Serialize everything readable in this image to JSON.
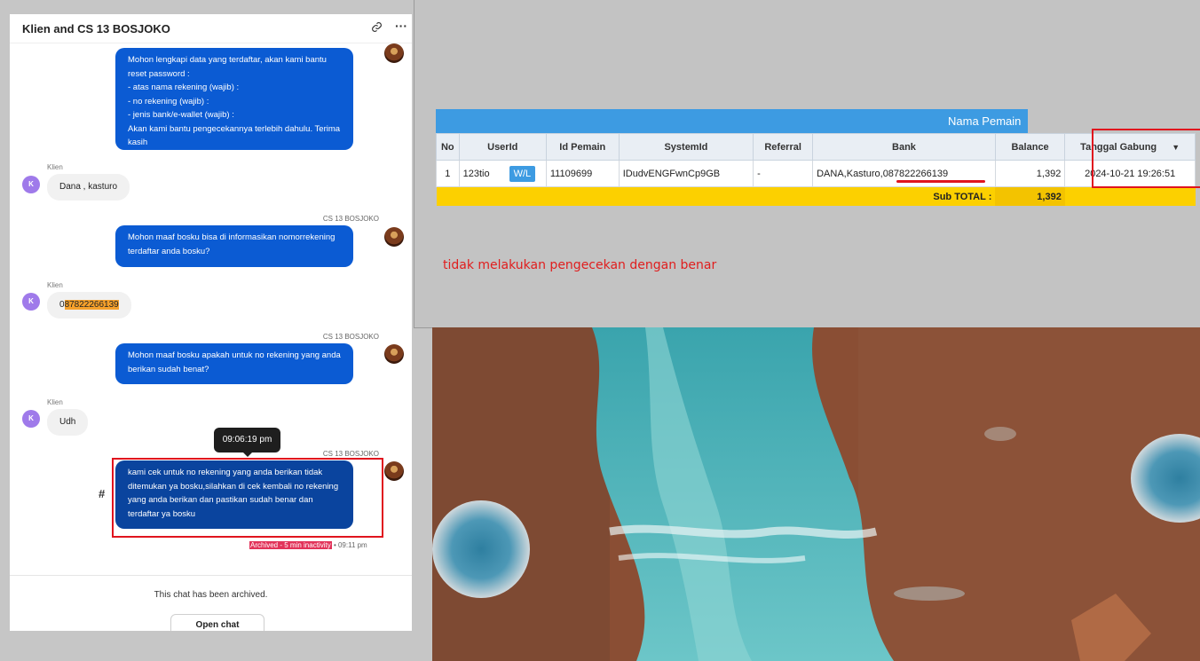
{
  "chat": {
    "title": "Klien and CS 13 BOSJOKO",
    "messages": [
      {
        "from": "agent",
        "text": "Mohon lengkapi data yang terdaftar, akan kami bantu reset password :\n- atas nama rekening (wajib) :\n- no rekening (wajib) :\n- jenis bank/e-wallet (wajib) :\nAkan kami bantu pengecekannya terlebih dahulu. Terima kasih"
      },
      {
        "sender": "Klien",
        "avatar": "K",
        "text": "Dana , kasturo"
      },
      {
        "sender": "CS 13 BOSJOKO",
        "text": "Mohon maaf bosku bisa di informasikan nomorrekening terdaftar anda bosku?"
      },
      {
        "sender": "Klien",
        "avatar": "K",
        "text_prefix": "0",
        "text_highlight": "87822266139"
      },
      {
        "sender": "CS 13 BOSJOKO",
        "text": "Mohon maaf bosku apakah untuk no rekening yang anda berikan sudah benat?"
      },
      {
        "sender": "Klien",
        "avatar": "K",
        "text": "Udh"
      },
      {
        "sender": "CS 13 BOSJOKO",
        "text": "kami cek untuk no rekening yang anda berikan tidak ditemukan ya bosku,silahkan di cek kembali no rekening yang anda berikan dan pastikan sudah benar dan terdaftar ya bosku"
      }
    ],
    "tooltip_time": "09:06:19 pm",
    "hash_symbol": "#",
    "archived_tag": "Archived - 5 min inactivity",
    "status_time": "• 09:11 pm",
    "archived_text": "This chat has been archived.",
    "open_chat_label": "Open chat",
    "icons": [
      "link-icon",
      "more-icon"
    ]
  },
  "admin": {
    "table_title": "Nama Pemain",
    "columns": [
      "No",
      "UserId",
      "Id Pemain",
      "SystemId",
      "Referral",
      "Bank",
      "Balance",
      "Tanggal Gabung"
    ],
    "row": {
      "no": "1",
      "userid": "123tio",
      "wl_label": "W/L",
      "id_pemain": "11109699",
      "systemid": "IDudvENGFwnCp9GB",
      "referral": "-",
      "bank": "DANA,Kasturo,087822266139",
      "balance": "1,392",
      "tanggal": "2024-10-21 19:26:51"
    },
    "subtotal_label": "Sub TOTAL :",
    "subtotal_value": "1,392",
    "note": "tidak melakukan pengecekan dengan benar",
    "colors": {
      "header": "#3d9be2",
      "subtotal": "#fcd000",
      "annotation": "#e0141e",
      "chat_bubble": "#0b5bd3"
    }
  }
}
